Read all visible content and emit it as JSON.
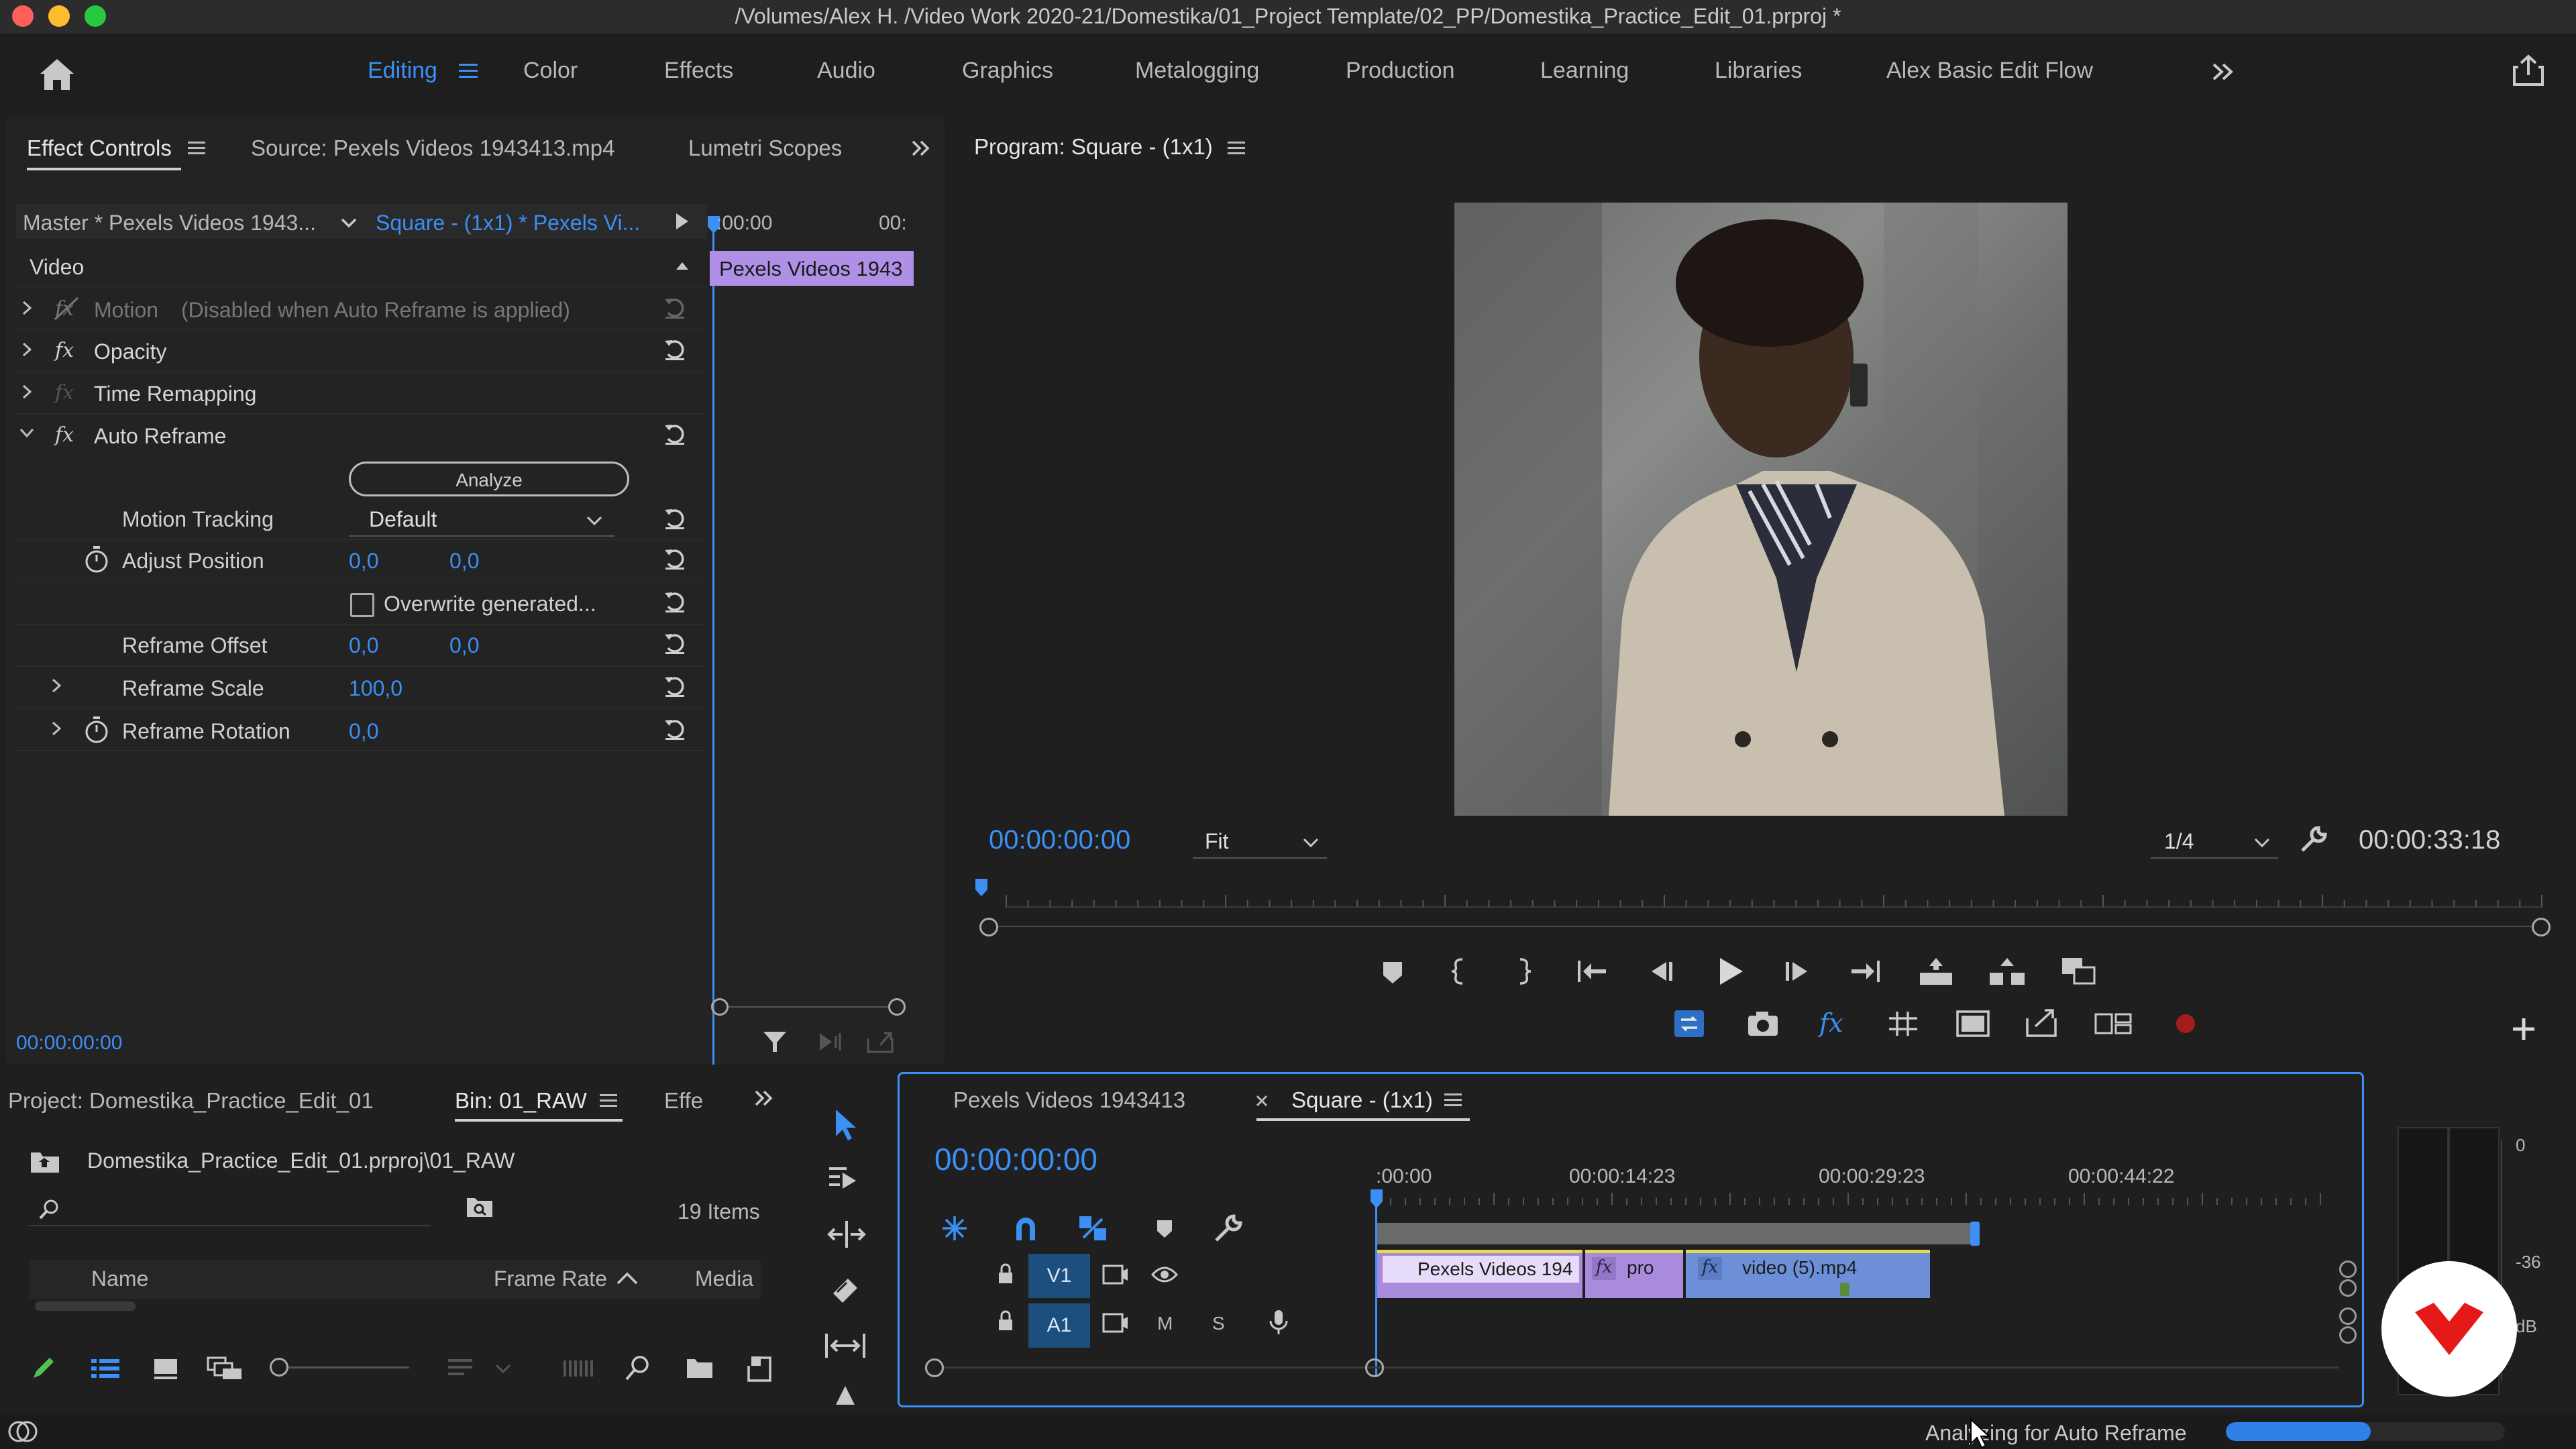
{
  "window": {
    "title": "/Volumes/Alex H. /Video Work 2020-21/Domestika/01_Project Template/02_PP/Domestika_Practice_Edit_01.prproj *"
  },
  "workspaces": {
    "items": [
      "Editing",
      "Color",
      "Effects",
      "Audio",
      "Graphics",
      "Metalogging",
      "Production",
      "Learning",
      "Libraries",
      "Alex Basic Edit Flow"
    ],
    "active": "Editing"
  },
  "effect_controls": {
    "tabs": [
      "Effect Controls",
      "Source: Pexels Videos 1943413.mp4",
      "Lumetri Scopes"
    ],
    "master_label": "Master * Pexels Videos 1943...",
    "sequence_label": "Square - (1x1) * Pexels Vi...",
    "mini_timeline": {
      "start": ":00:00",
      "end": "00:",
      "clip_label": "Pexels Videos 1943"
    },
    "section": "Video",
    "effects": [
      {
        "name": "Motion",
        "note": "(Disabled when Auto Reframe is applied)"
      },
      {
        "name": "Opacity"
      },
      {
        "name": "Time Remapping"
      },
      {
        "name": "Auto Reframe"
      }
    ],
    "analyze_label": "Analyze",
    "motion_tracking": {
      "label": "Motion Tracking",
      "value": "Default"
    },
    "adjust_position": {
      "label": "Adjust Position",
      "x": "0,0",
      "y": "0,0"
    },
    "overwrite_label": "Overwrite generated...",
    "reframe_offset": {
      "label": "Reframe Offset",
      "x": "0,0",
      "y": "0,0"
    },
    "reframe_scale": {
      "label": "Reframe Scale",
      "value": "100,0"
    },
    "reframe_rotation": {
      "label": "Reframe Rotation",
      "value": "0,0"
    },
    "timecode": "00:00:00:00"
  },
  "program_monitor": {
    "title": "Program: Square - (1x1)",
    "timecode": "00:00:00:00",
    "fit": "Fit",
    "resolution": "1/4",
    "duration": "00:00:33:18"
  },
  "project": {
    "tabs": [
      "Project: Domestika_Practice_Edit_01",
      "Bin: 01_RAW",
      "Effe"
    ],
    "path": "Domestika_Practice_Edit_01.prproj\\01_RAW",
    "items_count": "19 Items",
    "columns": [
      "Name",
      "Frame Rate",
      "Media"
    ]
  },
  "timeline": {
    "tabs": [
      "Pexels Videos 1943413",
      "Square - (1x1)"
    ],
    "timecode": "00:00:00:00",
    "ruler": [
      ":00:00",
      "00:00:14:23",
      "00:00:29:23",
      "00:00:44:22"
    ],
    "tracks": {
      "video": "V1",
      "audio": "A1",
      "mute": "M",
      "solo": "S"
    },
    "clips": [
      "Pexels Videos 194",
      "pro",
      "video (5).mp4"
    ]
  },
  "audio_meter": {
    "labels": [
      "0",
      "-36",
      "dB"
    ]
  },
  "status": {
    "text": "Analyzing for Auto Reframe",
    "progress": 0.52
  },
  "colors": {
    "accent": "#3b8ff5",
    "clip": "#a88bdc",
    "clip_blue": "#6d8fd8",
    "brand": "#e61919"
  }
}
